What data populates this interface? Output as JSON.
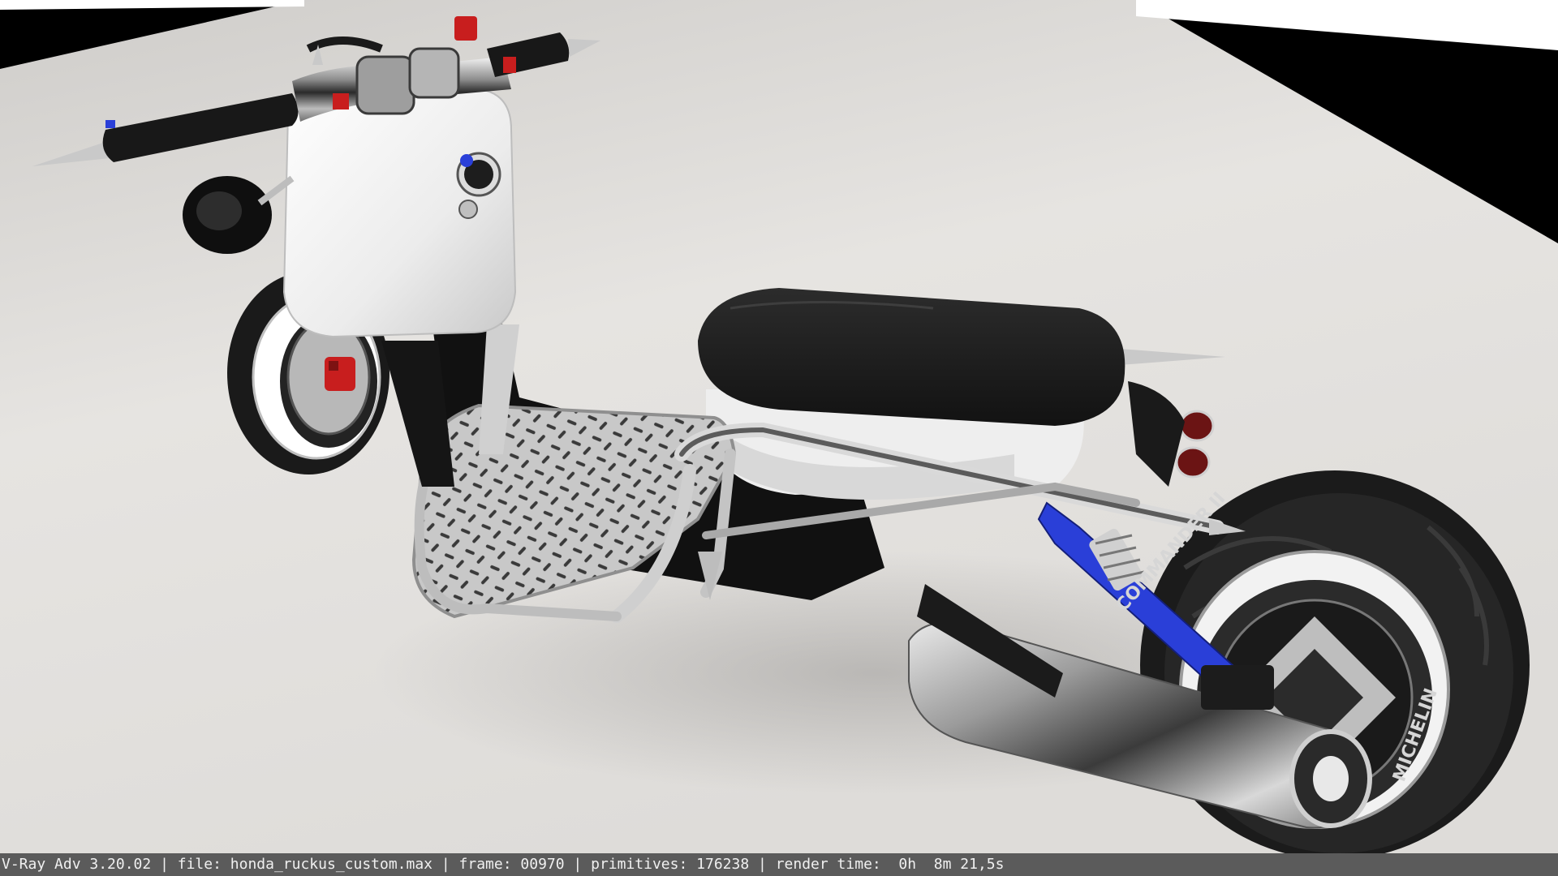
{
  "render_stamp": {
    "renderer": "V-Ray Adv 3.20.02",
    "file": "file: honda_ruckus_custom.max",
    "frame": "frame: 00970",
    "primitives": "primitives: 176238",
    "render_time": "render time:  0h  8m 21,5s",
    "separator": " | "
  },
  "scene": {
    "subject": "custom scooter render",
    "tire_brand": "MICHELIN",
    "tire_model": "COMMANDER II",
    "colors": {
      "backdrop": "#000000",
      "floor": "#e4e2df",
      "body_white": "#f2f2f2",
      "seat_black": "#1c1c1c",
      "chrome": "#c9c9c9",
      "shock_blue": "#2a3fd8",
      "caliper_red": "#c81e1e",
      "stamp_bar": "#5b5b5b"
    }
  }
}
